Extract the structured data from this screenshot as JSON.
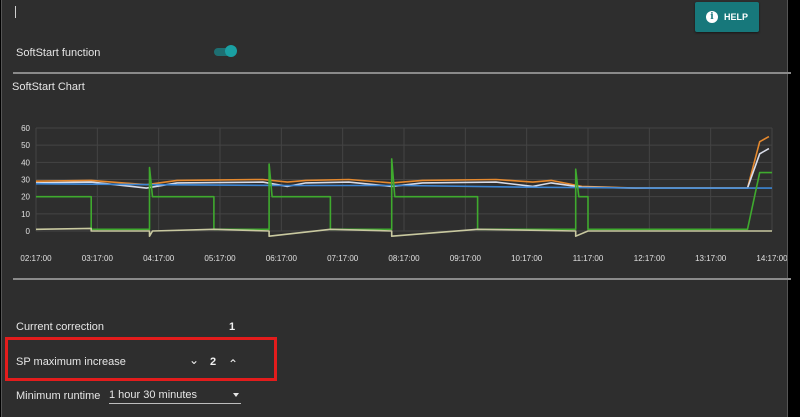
{
  "help_button": {
    "label": "HELP",
    "icon": "info-icon"
  },
  "softstart": {
    "label": "SoftStart function",
    "enabled": true,
    "accent": "#1aa0a3"
  },
  "chart_section": {
    "title": "SoftStart Chart"
  },
  "chart_data": {
    "type": "line",
    "title": "",
    "xlabel": "",
    "ylabel": "",
    "ylim": [
      0,
      60
    ],
    "yticks": [
      0,
      10,
      20,
      30,
      40,
      50,
      60
    ],
    "x_labels": [
      "02:17:00",
      "03:17:00",
      "04:17:00",
      "05:17:00",
      "06:17:00",
      "07:17:00",
      "08:17:00",
      "09:17:00",
      "10:17:00",
      "11:17:00",
      "12:17:00",
      "13:17:00",
      "14:17:00"
    ],
    "xlim": [
      0,
      12
    ],
    "grid": true,
    "series": [
      {
        "color": "#e5892e",
        "values": [
          [
            0,
            29
          ],
          [
            0.9,
            29.5
          ],
          [
            1.8,
            27
          ],
          [
            2.3,
            29.5
          ],
          [
            3.7,
            30
          ],
          [
            4.1,
            28.5
          ],
          [
            4.4,
            29.5
          ],
          [
            5.1,
            30
          ],
          [
            5.8,
            28
          ],
          [
            6.3,
            29.5
          ],
          [
            7.5,
            30
          ],
          [
            8.1,
            28.5
          ],
          [
            8.4,
            29.5
          ],
          [
            8.9,
            26
          ],
          [
            9.8,
            25
          ],
          [
            11.6,
            25
          ],
          [
            11.8,
            52
          ],
          [
            11.95,
            55
          ]
        ]
      },
      {
        "color": "#d9dce8",
        "values": [
          [
            0,
            28
          ],
          [
            0.9,
            28.5
          ],
          [
            1.8,
            25
          ],
          [
            2.3,
            28
          ],
          [
            3.7,
            28.5
          ],
          [
            4.1,
            26
          ],
          [
            4.4,
            28
          ],
          [
            5.1,
            28.5
          ],
          [
            5.8,
            26
          ],
          [
            6.3,
            28
          ],
          [
            7.5,
            28.5
          ],
          [
            8.1,
            26
          ],
          [
            8.4,
            28
          ],
          [
            8.9,
            25.5
          ],
          [
            9.8,
            25
          ],
          [
            11.6,
            25
          ],
          [
            11.8,
            45
          ],
          [
            11.95,
            48
          ]
        ]
      },
      {
        "color": "#3d86d4",
        "values": [
          [
            0,
            27.5
          ],
          [
            2,
            27
          ],
          [
            4,
            26.5
          ],
          [
            6,
            26.5
          ],
          [
            8,
            25.5
          ],
          [
            10,
            25
          ],
          [
            12,
            25
          ]
        ]
      },
      {
        "color": "#3faa2e",
        "values": [
          [
            0,
            20
          ],
          [
            0.9,
            20
          ],
          [
            0.9,
            1
          ],
          [
            1.85,
            1
          ],
          [
            1.85,
            37
          ],
          [
            1.9,
            20
          ],
          [
            2.9,
            20
          ],
          [
            2.9,
            1
          ],
          [
            3.8,
            1
          ],
          [
            3.8,
            39
          ],
          [
            3.85,
            20
          ],
          [
            4.8,
            20
          ],
          [
            4.8,
            1
          ],
          [
            5.8,
            1
          ],
          [
            5.8,
            42
          ],
          [
            5.85,
            20
          ],
          [
            7.2,
            20
          ],
          [
            7.2,
            1
          ],
          [
            8.8,
            1
          ],
          [
            8.8,
            36
          ],
          [
            8.85,
            20
          ],
          [
            9.0,
            20
          ],
          [
            9.0,
            1
          ],
          [
            11.6,
            1
          ],
          [
            11.8,
            34
          ],
          [
            12,
            34
          ]
        ]
      },
      {
        "color": "#c9c9a0",
        "values": [
          [
            0,
            1
          ],
          [
            0.9,
            1.5
          ],
          [
            0.9,
            0
          ],
          [
            1.85,
            0
          ],
          [
            1.85,
            -3
          ],
          [
            1.9,
            0
          ],
          [
            2.9,
            1
          ],
          [
            3.8,
            0
          ],
          [
            3.8,
            -3
          ],
          [
            4.8,
            1
          ],
          [
            5.8,
            0
          ],
          [
            5.8,
            -3
          ],
          [
            7.2,
            1
          ],
          [
            8.8,
            0
          ],
          [
            8.8,
            -3
          ],
          [
            9.0,
            0
          ],
          [
            12,
            0
          ]
        ]
      }
    ]
  },
  "current_correction": {
    "label": "Current correction",
    "value": "1"
  },
  "sp_max_increase": {
    "label": "SP maximum increase",
    "value": "2",
    "decrease_icon": "chevron-down-icon",
    "increase_icon": "chevron-up-icon"
  },
  "min_runtime": {
    "label": "Minimum runtime",
    "selected": "1 hour 30 minutes"
  }
}
